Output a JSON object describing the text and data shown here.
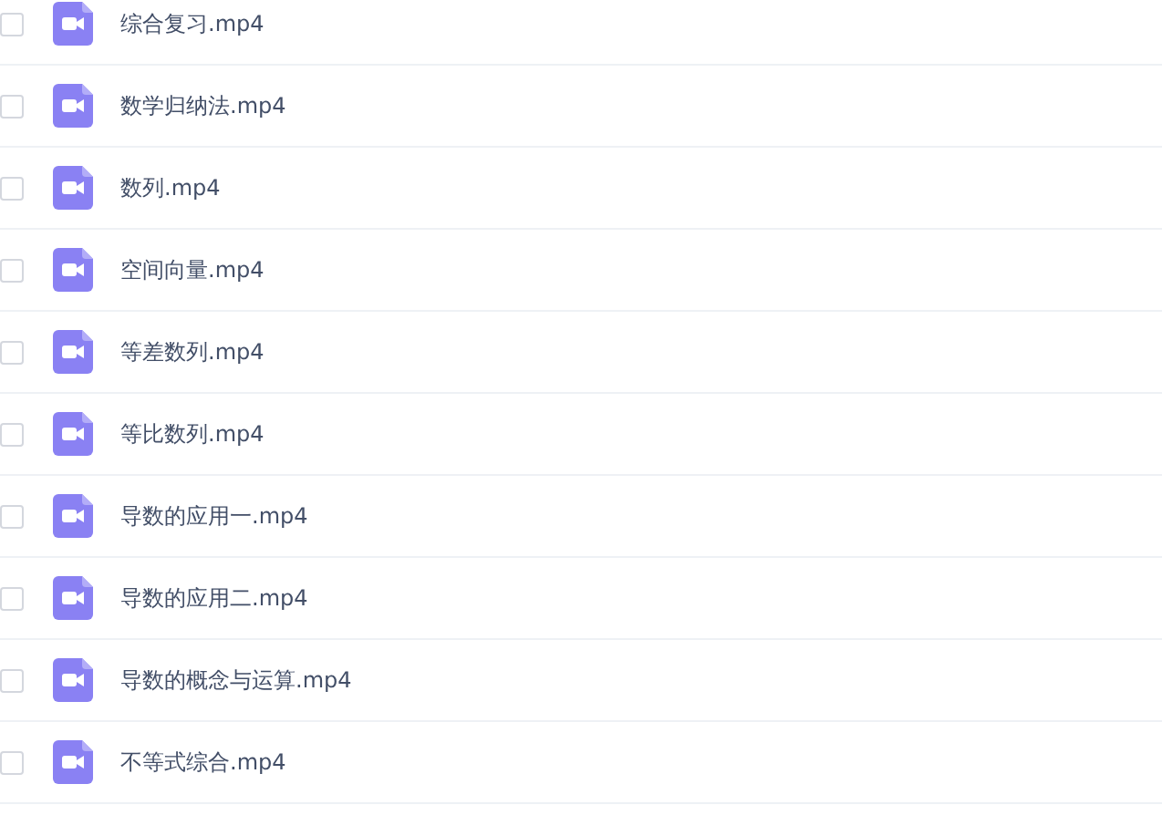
{
  "files": [
    {
      "name": "综合复习.mp4",
      "checked": false
    },
    {
      "name": "数学归纳法.mp4",
      "checked": false
    },
    {
      "name": "数列.mp4",
      "checked": false
    },
    {
      "name": "空间向量.mp4",
      "checked": false
    },
    {
      "name": "等差数列.mp4",
      "checked": false
    },
    {
      "name": "等比数列.mp4",
      "checked": false
    },
    {
      "name": "导数的应用一.mp4",
      "checked": false
    },
    {
      "name": "导数的应用二.mp4",
      "checked": false
    },
    {
      "name": "导数的概念与运算.mp4",
      "checked": false
    },
    {
      "name": "不等式综合.mp4",
      "checked": false
    }
  ]
}
